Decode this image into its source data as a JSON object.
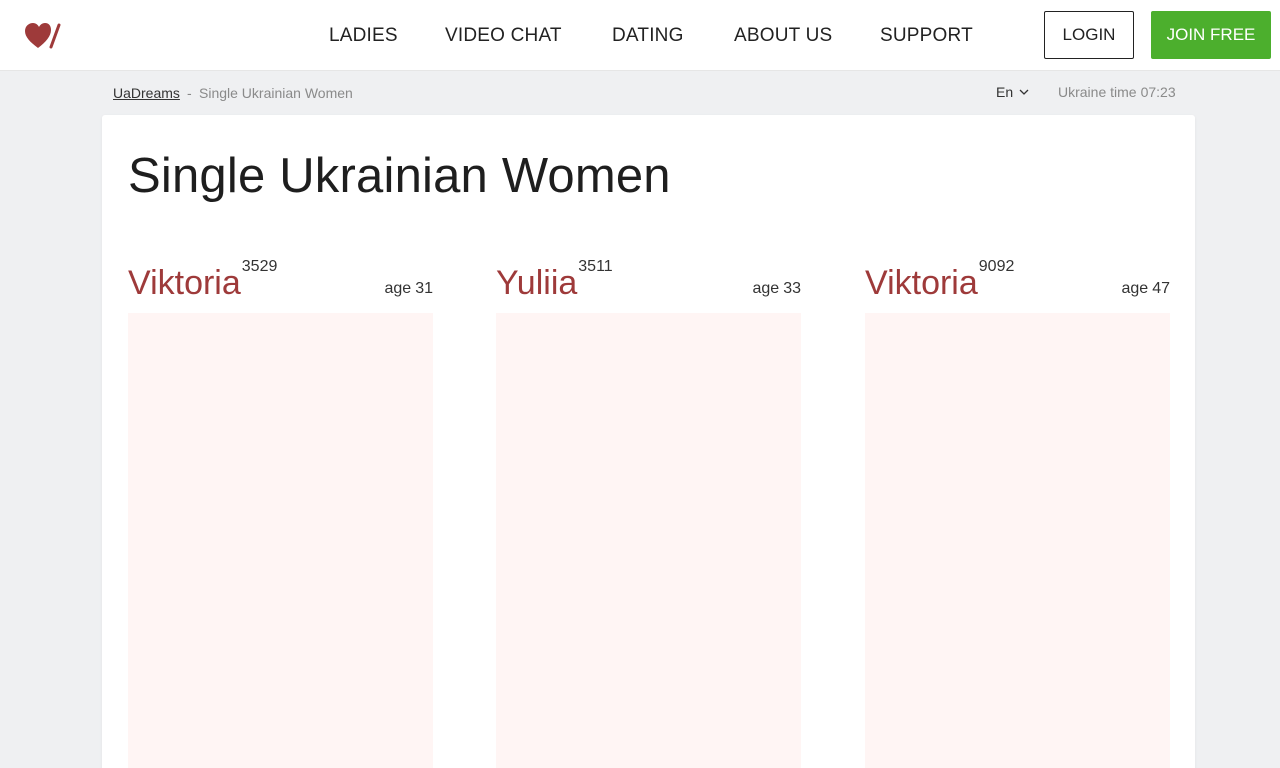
{
  "brand": {
    "logo_icon": "heart-slash-logo-icon",
    "color": "#9e3a3a"
  },
  "nav": {
    "items": [
      {
        "label": "LADIES"
      },
      {
        "label": "VIDEO CHAT"
      },
      {
        "label": "DATING"
      },
      {
        "label": "ABOUT US"
      },
      {
        "label": "SUPPORT"
      }
    ],
    "login_label": "LOGIN",
    "join_label": "JOIN FREE",
    "join_color": "#4caf2d"
  },
  "breadcrumb": {
    "home": "UaDreams",
    "separator": "-",
    "current": "Single Ukrainian Women"
  },
  "language": {
    "selected": "En",
    "icon": "chevron-down-icon"
  },
  "ukraine_time": {
    "label": "Ukraine time",
    "value": "07:23"
  },
  "page": {
    "title": "Single Ukrainian Women"
  },
  "profiles": [
    {
      "name": "Viktoria",
      "id": "3529",
      "age_label": "age",
      "age": "31"
    },
    {
      "name": "Yuliia",
      "id": "3511",
      "age_label": "age",
      "age": "33"
    },
    {
      "name": "Viktoria",
      "id": "9092",
      "age_label": "age",
      "age": "47"
    }
  ]
}
